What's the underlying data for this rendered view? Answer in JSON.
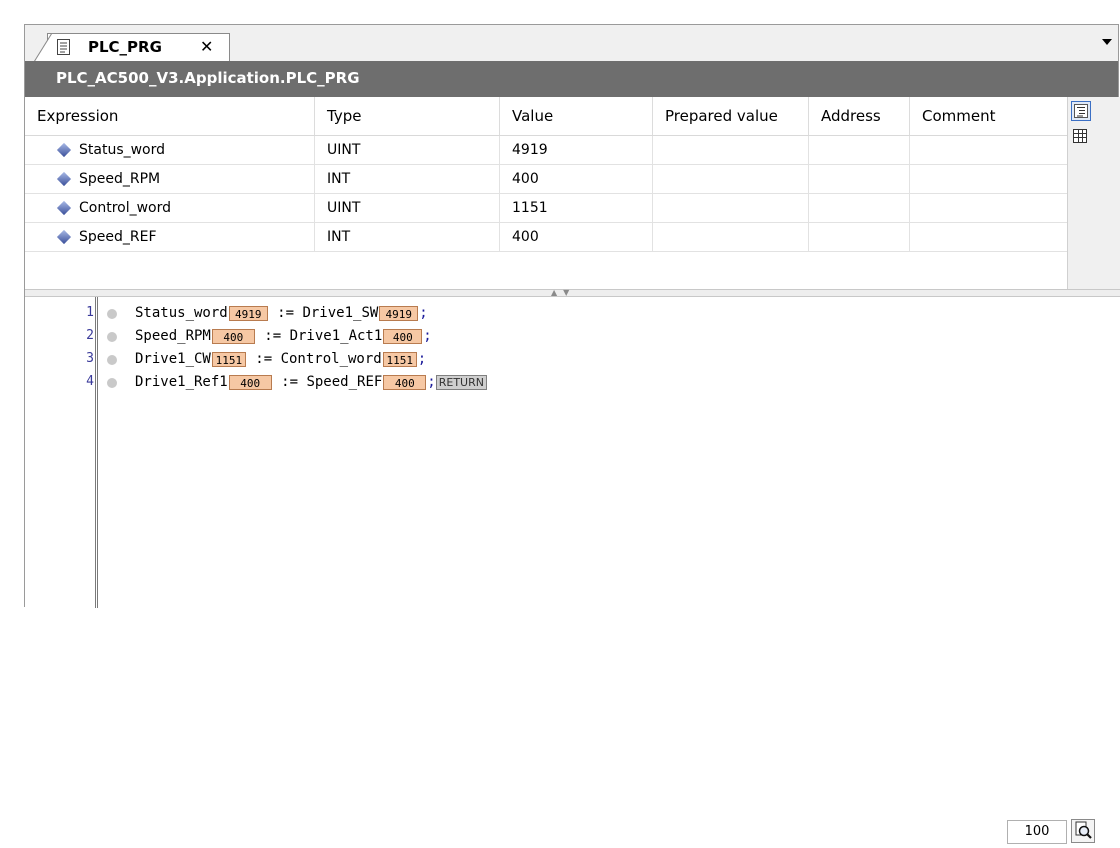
{
  "tab": {
    "title": "PLC_PRG",
    "close": "✕"
  },
  "path": "PLC_AC500_V3.Application.PLC_PRG",
  "watch": {
    "columns": [
      "Expression",
      "Type",
      "Value",
      "Prepared value",
      "Address",
      "Comment"
    ],
    "rows": [
      {
        "expression": "Status_word",
        "type": "UINT",
        "value": "4919",
        "prepared": "",
        "address": "",
        "comment": ""
      },
      {
        "expression": "Speed_RPM",
        "type": "INT",
        "value": "400",
        "prepared": "",
        "address": "",
        "comment": ""
      },
      {
        "expression": "Control_word",
        "type": "UINT",
        "value": "1151",
        "prepared": "",
        "address": "",
        "comment": ""
      },
      {
        "expression": "Speed_REF",
        "type": "INT",
        "value": "400",
        "prepared": "",
        "address": "",
        "comment": ""
      }
    ]
  },
  "code": {
    "lines": [
      {
        "num": "1",
        "lhs": "Status_word",
        "lhs_val": "4919",
        "op": " := ",
        "rhs": "Drive1_SW",
        "rhs_val": "4919",
        "end": ";"
      },
      {
        "num": "2",
        "lhs": "Speed_RPM",
        "lhs_val": "400",
        "op": " := ",
        "rhs": "Drive1_Act1",
        "rhs_val": "400",
        "end": ";"
      },
      {
        "num": "3",
        "lhs": "Drive1_CW",
        "lhs_val": "1151",
        "op": " := ",
        "rhs": "Control_word",
        "rhs_val": "1151",
        "end": ";"
      },
      {
        "num": "4",
        "lhs": "Drive1_Ref1",
        "lhs_val": "400",
        "op": " := ",
        "rhs": "Speed_REF",
        "rhs_val": "400",
        "end": ";",
        "flag": "RETURN"
      }
    ]
  },
  "zoom": "100",
  "icons": {
    "tab": "document-icon",
    "variable": "variable-diamond-icon",
    "side_top": "list-view-icon",
    "side_bottom": "table-view-icon",
    "zoom": "magnifier-icon"
  },
  "colors": {
    "path_bar": "#6e6e6e",
    "monitor_box": "#f6c8a4",
    "line_number": "#3a3a9a"
  }
}
